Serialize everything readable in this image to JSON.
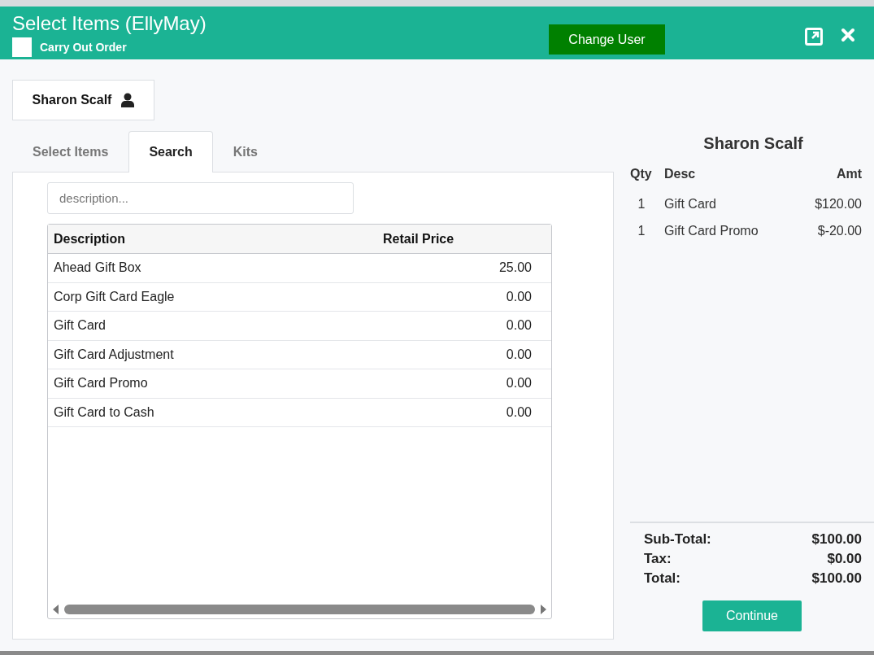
{
  "window": {
    "title": "Select Items (EllyMay)",
    "carry_out_order": {
      "label": "Carry Out Order",
      "checked": false
    },
    "change_user_button": "Change User"
  },
  "customer_button": "Sharon Scalf",
  "tabs": [
    {
      "label": "Select Items",
      "selected": false
    },
    {
      "label": "Search",
      "selected": true
    },
    {
      "label": "Kits",
      "selected": false
    }
  ],
  "search": {
    "placeholder": "description..."
  },
  "table": {
    "columns": [
      "Description",
      "Retail Price"
    ],
    "rows": [
      [
        "Ahead Gift Box",
        "25.00"
      ],
      [
        "Corp Gift Card Eagle",
        "0.00"
      ],
      [
        "Gift Card",
        "0.00"
      ],
      [
        "Gift Card Adjustment",
        "0.00"
      ],
      [
        "Gift Card Promo",
        "0.00"
      ],
      [
        "Gift Card to Cash",
        "0.00"
      ]
    ]
  },
  "order": {
    "customer": "Sharon Scalf",
    "columns": [
      "Qty",
      "Desc",
      "Amt"
    ],
    "lines": [
      {
        "qty": "1",
        "desc": "Gift Card",
        "amt": "$120.00"
      },
      {
        "qty": "1",
        "desc": "Gift Card Promo",
        "amt": "$-20.00"
      }
    ],
    "totals": [
      {
        "label": "Sub-Total:",
        "value": "$100.00"
      },
      {
        "label": "Tax:",
        "value": "$0.00"
      },
      {
        "label": "Total:",
        "value": "$100.00"
      }
    ],
    "continue_button": "Continue"
  }
}
